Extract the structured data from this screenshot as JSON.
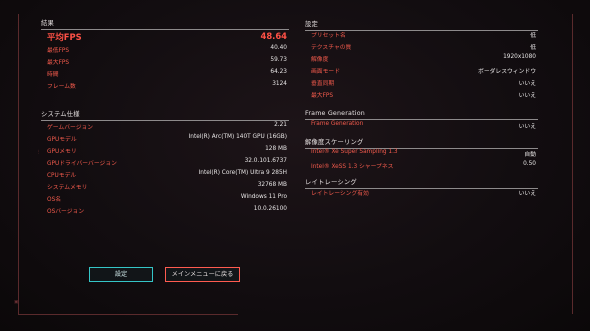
{
  "results": {
    "heading": "結果",
    "avg_fps": {
      "label": "平均FPS",
      "value": "48.64"
    },
    "rows": [
      {
        "label": "最低FPS",
        "value": "40.40"
      },
      {
        "label": "最大FPS",
        "value": "59.73"
      },
      {
        "label": "時間",
        "value": "64.23"
      },
      {
        "label": "フレーム数",
        "value": "3124"
      }
    ]
  },
  "system": {
    "heading": "システム仕様",
    "rows": [
      {
        "label": "ゲームバージョン",
        "value": "2.21"
      },
      {
        "label": "GPUモデル",
        "value": "Intel(R) Arc(TM) 140T GPU (16GB)"
      },
      {
        "label": "GPUメモリ",
        "value": "128 MB"
      },
      {
        "label": "GPUドライバーバージョン",
        "value": "32.0.101.6737"
      },
      {
        "label": "CPUモデル",
        "value": "Intel(R) Core(TM) Ultra 9 285H"
      },
      {
        "label": "システムメモリ",
        "value": "32768 MB"
      },
      {
        "label": "OS名",
        "value": "Windows 11 Pro"
      },
      {
        "label": "OSバージョン",
        "value": "10.0.26100"
      }
    ]
  },
  "settings": {
    "heading": "設定",
    "rows": [
      {
        "label": "プリセット名",
        "value": "低"
      },
      {
        "label": "テクスチャの質",
        "value": "低"
      },
      {
        "label": "解像度",
        "value": "1920x1080"
      },
      {
        "label": "画面モード",
        "value": "ボーダレスウィンドウ"
      },
      {
        "label": "垂直同期",
        "value": "いいえ"
      },
      {
        "label": "最大FPS",
        "value": "いいえ"
      }
    ]
  },
  "frame_generation": {
    "heading": "Frame Generation",
    "rows": [
      {
        "label": "Frame Generation",
        "value": "いいえ"
      }
    ]
  },
  "upscaling": {
    "heading": "解像度スケーリング",
    "rows": [
      {
        "label": "Intel® Xe Super Sampling 1.3",
        "value": "自動"
      },
      {
        "label": "Intel® XeSS 1.3 シャープネス",
        "value": "0.50"
      }
    ]
  },
  "raytracing": {
    "heading": "レイトレーシング",
    "rows": [
      {
        "label": "レイトレーシング有効",
        "value": "いいえ"
      }
    ]
  },
  "buttons": {
    "settings": "設定",
    "main_menu": "メインメニューに戻る"
  },
  "colors": {
    "accent_red": "#f25a4c",
    "accent_cyan": "#35c5c7",
    "bg": "#120d10"
  }
}
